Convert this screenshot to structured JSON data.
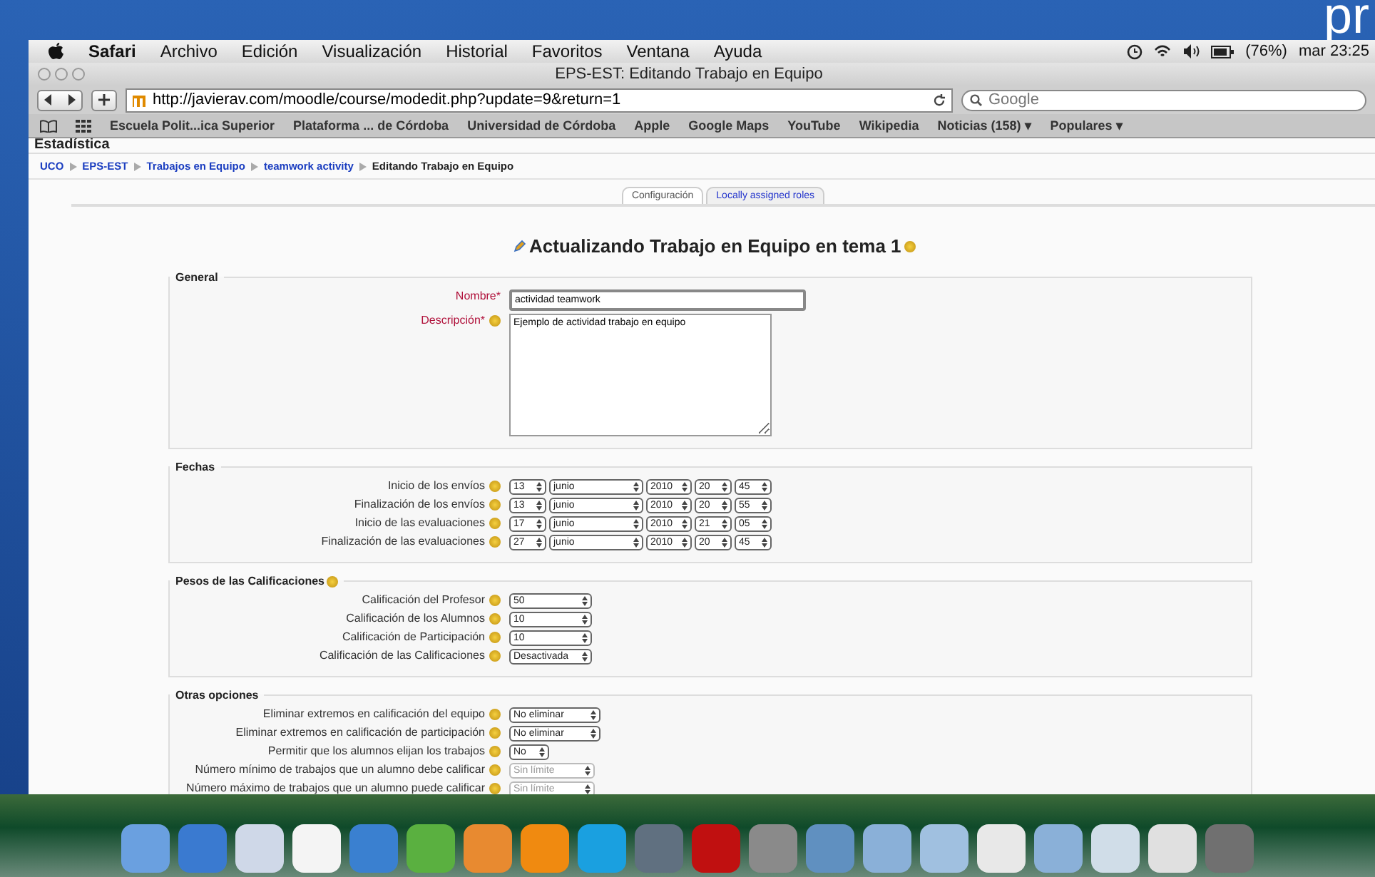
{
  "desktop": {
    "corner_text": "pr"
  },
  "menu_bar": {
    "app": "Safari",
    "items": [
      "Archivo",
      "Edición",
      "Visualización",
      "Historial",
      "Favoritos",
      "Ventana",
      "Ayuda"
    ],
    "battery": "(76%)",
    "clock": "mar 23:25"
  },
  "window": {
    "title": "EPS-EST: Editando Trabajo en Equipo"
  },
  "toolbar": {
    "url": "http://javierav.com/moodle/course/modedit.php?update=9&return=1",
    "search_placeholder": "Google"
  },
  "bookmarks": [
    "Escuela Polit...ica Superior",
    "Plataforma ... de Córdoba",
    "Universidad de Córdoba",
    "Apple",
    "Google Maps",
    "YouTube",
    "Wikipedia",
    "Noticias (158) ▾",
    "Populares ▾"
  ],
  "page": {
    "cut_heading": "Estadística",
    "breadcrumb": [
      {
        "label": "UCO",
        "link": true
      },
      {
        "label": "EPS-EST",
        "link": true
      },
      {
        "label": "Trabajos en Equipo",
        "link": true
      },
      {
        "label": "teamwork activity",
        "link": true
      },
      {
        "label": "Editando Trabajo en Equipo",
        "link": false
      }
    ],
    "tabs": [
      {
        "label": "Configuración",
        "selected": true
      },
      {
        "label": "Locally assigned roles",
        "selected": false
      }
    ],
    "heading": "Actualizando Trabajo en Equipo en tema 1",
    "fieldsets": [
      {
        "legend": "General",
        "help": false,
        "rows": [
          {
            "kind": "text",
            "label": "Nombre*",
            "required": true,
            "help": false,
            "value": "actividad teamwork"
          },
          {
            "kind": "textarea",
            "label": "Descripción*",
            "required": true,
            "help": true,
            "value": "Ejemplo de actividad trabajo en equipo"
          }
        ]
      },
      {
        "legend": "Fechas",
        "help": false,
        "rows": [
          {
            "kind": "date",
            "label": "Inicio de los envíos",
            "required": false,
            "help": true,
            "values": [
              "13",
              "junio",
              "2010",
              "20",
              "45"
            ]
          },
          {
            "kind": "date",
            "label": "Finalización de los envíos",
            "required": false,
            "help": true,
            "values": [
              "13",
              "junio",
              "2010",
              "20",
              "55"
            ]
          },
          {
            "kind": "date",
            "label": "Inicio de las evaluaciones",
            "required": false,
            "help": true,
            "values": [
              "17",
              "junio",
              "2010",
              "21",
              "05"
            ]
          },
          {
            "kind": "date",
            "label": "Finalización de las evaluaciones",
            "required": false,
            "help": true,
            "values": [
              "27",
              "junio",
              "2010",
              "20",
              "45"
            ]
          }
        ]
      },
      {
        "legend": "Pesos de las Calificaciones",
        "help": true,
        "rows": [
          {
            "kind": "grade",
            "label": "Calificación del Profesor",
            "required": false,
            "help": true,
            "value": "50",
            "disabled": false
          },
          {
            "kind": "grade",
            "label": "Calificación de los Alumnos",
            "required": false,
            "help": true,
            "value": "10",
            "disabled": false
          },
          {
            "kind": "grade",
            "label": "Calificación de Participación",
            "required": false,
            "help": true,
            "value": "10",
            "disabled": false
          },
          {
            "kind": "grade",
            "label": "Calificación de las Calificaciones",
            "required": false,
            "help": true,
            "value": "Desactivada",
            "disabled": false
          }
        ]
      },
      {
        "legend": "Otras opciones",
        "help": false,
        "rows": [
          {
            "kind": "select",
            "label": "Eliminar extremos en calificación del equipo",
            "required": false,
            "help": true,
            "value": "No eliminar",
            "disabled": false
          },
          {
            "kind": "select",
            "label": "Eliminar extremos en calificación de participación",
            "required": false,
            "help": true,
            "value": "No eliminar",
            "disabled": false
          },
          {
            "kind": "select",
            "label": "Permitir que los alumnos elijan los trabajos",
            "required": false,
            "help": true,
            "value": "No",
            "disabled": false
          },
          {
            "kind": "select",
            "label": "Número mínimo de trabajos que un alumno debe calificar",
            "required": false,
            "help": true,
            "value": "Sin límite",
            "disabled": true
          },
          {
            "kind": "select",
            "label": "Número máximo de trabajos que un alumno puede calificar",
            "required": false,
            "help": true,
            "value": "Sin límite",
            "disabled": true
          }
        ]
      }
    ]
  }
}
